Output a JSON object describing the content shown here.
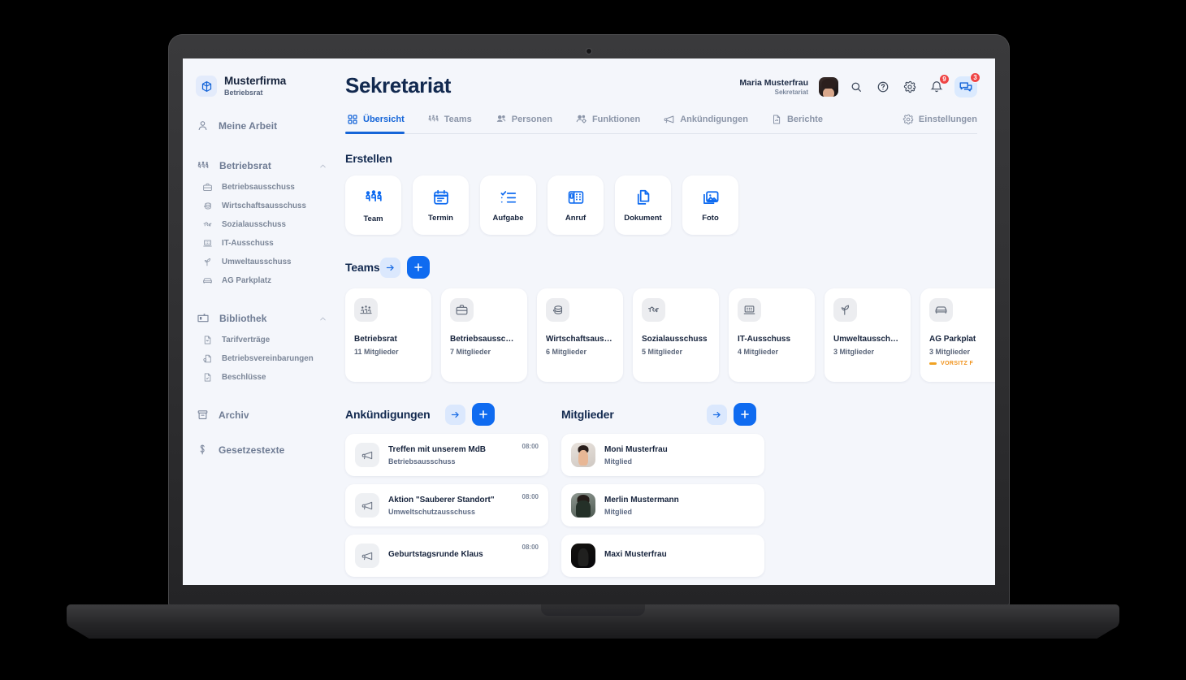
{
  "brand": {
    "name": "Musterfirma",
    "subtitle": "Betriebsrat",
    "logo_icon": "cube-icon"
  },
  "sidebar": {
    "items": [
      {
        "label": "Meine Arbeit",
        "icon": "user-icon"
      }
    ],
    "groups": [
      {
        "label": "Betriebsrat",
        "icon": "people-group-icon",
        "chevron": "chevron-up-icon",
        "children": [
          {
            "label": "Betriebsausschuss",
            "icon": "briefcase-icon"
          },
          {
            "label": "Wirtschaftsausschuss",
            "icon": "coins-icon"
          },
          {
            "label": "Sozialausschuss",
            "icon": "handshake-icon"
          },
          {
            "label": "IT-Ausschuss",
            "icon": "laptop-icon"
          },
          {
            "label": "Umweltausschuss",
            "icon": "sprout-icon"
          },
          {
            "label": "AG Parkplatz",
            "icon": "car-icon"
          }
        ]
      },
      {
        "label": "Bibliothek",
        "icon": "shelf-icon",
        "chevron": "chevron-up-icon",
        "children": [
          {
            "label": "Tarifverträge",
            "icon": "document-icon"
          },
          {
            "label": "Betriebsvereinbarungen",
            "icon": "document-key-icon"
          },
          {
            "label": "Beschlüsse",
            "icon": "document-check-icon"
          }
        ]
      }
    ],
    "footer_items": [
      {
        "label": "Archiv",
        "icon": "archive-icon"
      },
      {
        "label": "Gesetzestexte",
        "icon": "paragraph-icon"
      }
    ]
  },
  "header": {
    "title": "Sekretariat",
    "user": {
      "name": "Maria Musterfrau",
      "role": "Sekretariat",
      "avatar": "avatar"
    },
    "actions": [
      {
        "icon": "search-icon",
        "badge": ""
      },
      {
        "icon": "help-circle-icon",
        "badge": ""
      },
      {
        "icon": "gear-icon",
        "badge": ""
      },
      {
        "icon": "bell-icon",
        "badge": "9"
      },
      {
        "icon": "chat-icon",
        "badge": "3"
      }
    ]
  },
  "tabs": [
    {
      "label": "Übersicht",
      "icon": "grid-icon",
      "active": true
    },
    {
      "label": "Teams",
      "icon": "people-group-icon",
      "active": false
    },
    {
      "label": "Personen",
      "icon": "persons-icon",
      "active": false
    },
    {
      "label": "Funktionen",
      "icon": "persons-gear-icon",
      "active": false
    },
    {
      "label": "Ankündigungen",
      "icon": "megaphone-icon",
      "active": false
    },
    {
      "label": "Berichte",
      "icon": "report-icon",
      "active": false
    },
    {
      "label": "Einstellungen",
      "icon": "gear-icon",
      "active": false
    }
  ],
  "create": {
    "title": "Erstellen",
    "items": [
      {
        "label": "Team",
        "icon": "people-group-icon"
      },
      {
        "label": "Termin",
        "icon": "calendar-icon"
      },
      {
        "label": "Aufgabe",
        "icon": "checklist-icon"
      },
      {
        "label": "Anruf",
        "icon": "desk-phone-icon"
      },
      {
        "label": "Dokument",
        "icon": "copy-document-icon"
      },
      {
        "label": "Foto",
        "icon": "image-icon"
      }
    ]
  },
  "teams": {
    "title": "Teams",
    "next_icon": "arrow-right-icon",
    "add_icon": "plus-icon",
    "items": [
      {
        "name": "Betriebsrat",
        "members": "11 Mitglieder",
        "icon": "assembly-icon",
        "flag": ""
      },
      {
        "name": "Betriebsausschu...",
        "members": "7 Mitglieder",
        "icon": "briefcase-icon",
        "flag": ""
      },
      {
        "name": "Wirtschaftsauss...",
        "members": "6 Mitglieder",
        "icon": "coins-icon",
        "flag": ""
      },
      {
        "name": "Sozialausschuss",
        "members": "5 Mitglieder",
        "icon": "handshake-icon",
        "flag": ""
      },
      {
        "name": "IT-Ausschuss",
        "members": "4 Mitglieder",
        "icon": "laptop-icon",
        "flag": ""
      },
      {
        "name": "Umweltausschuss",
        "members": "3 Mitglieder",
        "icon": "sprout-icon",
        "flag": ""
      },
      {
        "name": "AG Parkplat",
        "members": "3 Mitglieder",
        "icon": "car-icon",
        "flag": "VORSITZ F"
      }
    ]
  },
  "announcements": {
    "title": "Ankündigungen",
    "next_icon": "arrow-right-icon",
    "add_icon": "plus-icon",
    "items": [
      {
        "title": "Treffen mit unserem MdB",
        "subtitle": "Betriebsausschuss",
        "time": "08:00",
        "icon": "megaphone-icon"
      },
      {
        "title": "Aktion \"Sauberer Standort\"",
        "subtitle": "Umweltschutzausschuss",
        "time": "08:00",
        "icon": "megaphone-icon"
      },
      {
        "title": "Geburtstagsrunde Klaus",
        "subtitle": "",
        "time": "08:00",
        "icon": "megaphone-icon"
      }
    ]
  },
  "members": {
    "title": "Mitglieder",
    "next_icon": "arrow-right-icon",
    "add_icon": "plus-icon",
    "items": [
      {
        "name": "Moni Musterfrau",
        "role": "Mitglied",
        "avatar": "avatar-woman"
      },
      {
        "name": "Merlin Mustermann",
        "role": "Mitglied",
        "avatar": "avatar-man"
      },
      {
        "name": "Maxi Musterfrau",
        "role": "",
        "avatar": "avatar-dark"
      }
    ]
  },
  "colors": {
    "accent": "#0f6bf0",
    "accent_soft": "#dbe8fd",
    "title": "#12294f",
    "muted": "#7b8699",
    "badge": "#ef4444",
    "flag": "#f0921a",
    "canvas": "#f4f6fb"
  }
}
